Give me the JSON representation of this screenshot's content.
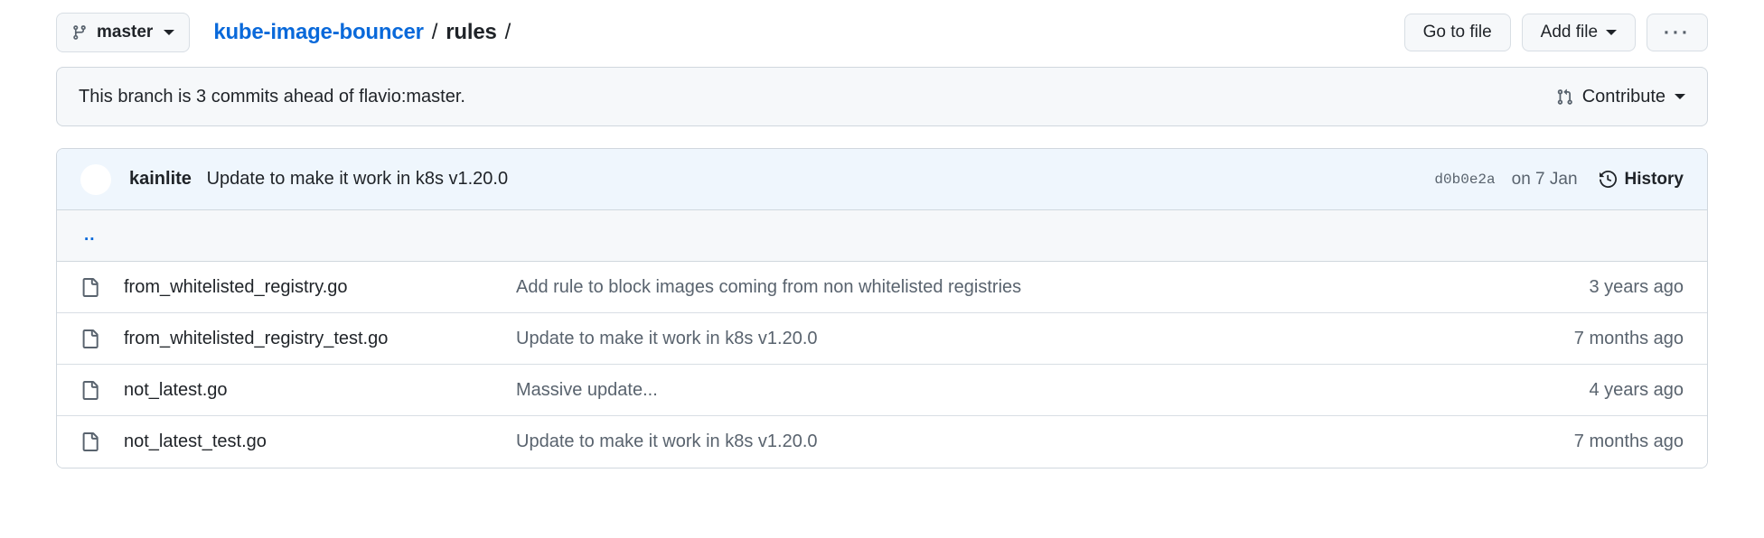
{
  "header": {
    "branch_selector": {
      "icon": "git-branch-icon",
      "label": "master",
      "caret": "chevron-down-icon"
    },
    "breadcrumb": {
      "repo": "kube-image-bouncer",
      "separator": "/",
      "current": "rules",
      "trailing_separator": "/"
    },
    "actions": {
      "go_to_file": "Go to file",
      "add_file": "Add file",
      "add_file_caret": "chevron-down-icon",
      "kebab": "···"
    }
  },
  "branch_banner": {
    "status_text": "This branch is 3 commits ahead of flavio:master.",
    "contribute_label": "Contribute",
    "contribute_icon": "git-pull-request-icon",
    "contribute_caret": "chevron-down-icon"
  },
  "latest_commit": {
    "avatar": "avatar-kainlite",
    "author": "kainlite",
    "message": "Update to make it work in k8s v1.20.0",
    "sha": "d0b0e2a",
    "date": "on 7 Jan",
    "history_label": "History",
    "history_icon": "history-clock-icon"
  },
  "parent_dir": {
    "label": ".."
  },
  "files": [
    {
      "icon": "file-icon",
      "name": "from_whitelisted_registry.go",
      "message": "Add rule to block images coming from non whitelisted registries",
      "age": "3 years ago"
    },
    {
      "icon": "file-icon",
      "name": "from_whitelisted_registry_test.go",
      "message": "Update to make it work in k8s v1.20.0",
      "age": "7 months ago"
    },
    {
      "icon": "file-icon",
      "name": "not_latest.go",
      "message": "Massive update...",
      "age": "4 years ago"
    },
    {
      "icon": "file-icon",
      "name": "not_latest_test.go",
      "message": "Update to make it work in k8s v1.20.0",
      "age": "7 months ago"
    }
  ],
  "colors": {
    "link_blue": "#0969da",
    "text_primary": "#1f2328",
    "text_muted": "#59636e",
    "border": "#d0d7de",
    "surface_subtle": "#f6f8fa",
    "highlight_row": "#eff6fd"
  }
}
